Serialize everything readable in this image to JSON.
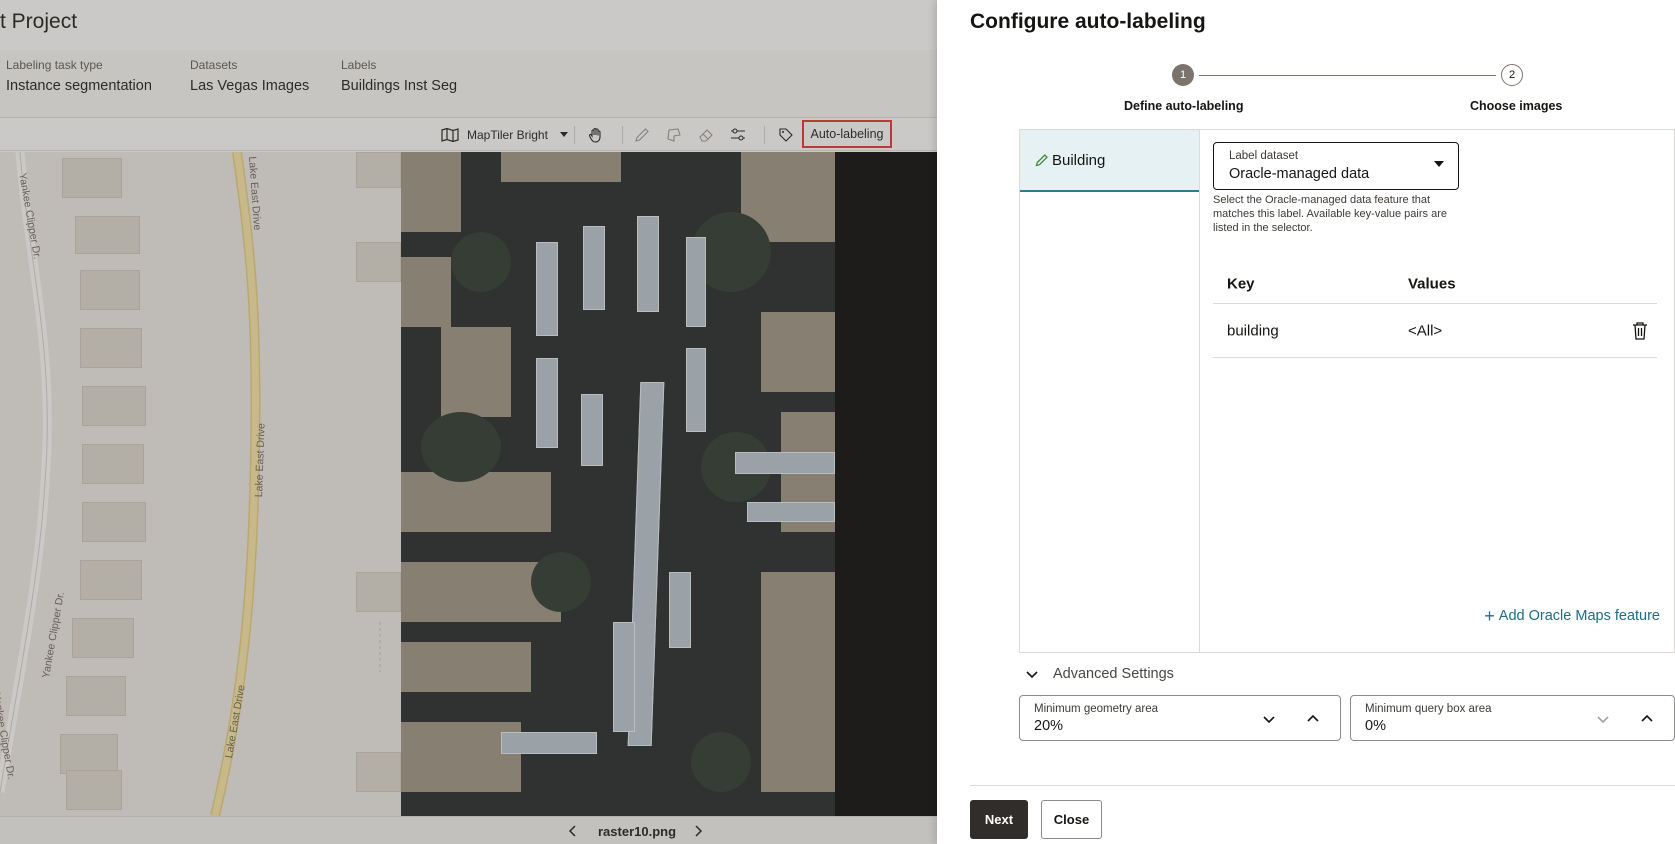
{
  "app": {
    "title": "t Project",
    "meta": [
      {
        "key": "Labeling task type",
        "value": "Instance segmentation"
      },
      {
        "key": "Datasets",
        "value": "Las Vegas Images"
      },
      {
        "key": "Labels",
        "value": "Buildings Inst Seg"
      }
    ],
    "toolbar": {
      "basemap": "MapTiler Bright",
      "auto_labeling": "Auto-labeling"
    },
    "map_labels": [
      "Yankee Clipper Dr.",
      "Lake East Drive",
      "Yankee Clipper Dr.",
      "Lake East Drive",
      "Lake East Drive",
      "Yankee Clipper Dr."
    ],
    "file_name": "raster10.png"
  },
  "drawer": {
    "title": "Configure auto-labeling",
    "steps": [
      {
        "number": "1",
        "label": "Define auto-labeling"
      },
      {
        "number": "2",
        "label": "Choose images"
      }
    ],
    "labels": [
      "Building"
    ],
    "label_dataset": {
      "label": "Label dataset",
      "value": "Oracle-managed data",
      "help": "Select the Oracle-managed data feature that matches this label. Available key-value pairs are listed in the selector."
    },
    "table": {
      "headers": [
        "Key",
        "Values"
      ],
      "rows": [
        {
          "key": "building",
          "value": "<All>"
        }
      ]
    },
    "add_link": "Add Oracle Maps feature",
    "advanced": {
      "title": "Advanced Settings",
      "min_geometry": {
        "label": "Minimum geometry area",
        "value": "20%"
      },
      "min_query_box": {
        "label": "Minimum query box area",
        "value": "0%"
      }
    },
    "buttons": {
      "next": "Next",
      "close": "Close"
    }
  }
}
